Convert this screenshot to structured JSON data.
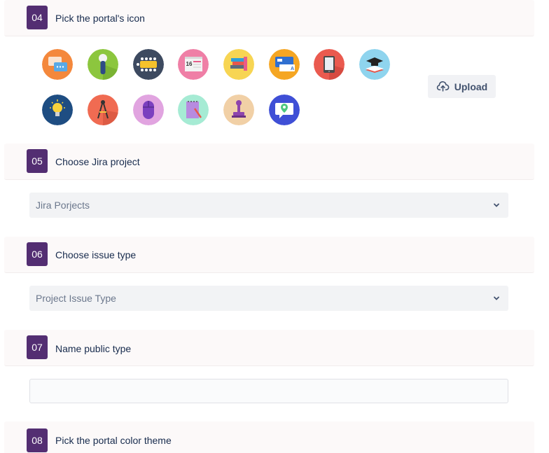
{
  "steps": [
    {
      "number": "04",
      "title": "Pick the portal's icon"
    },
    {
      "number": "05",
      "title": "Choose Jira project"
    },
    {
      "number": "06",
      "title": "Choose issue type"
    },
    {
      "number": "07",
      "title": "Name public type"
    },
    {
      "number": "08",
      "title": "Pick the portal color theme"
    }
  ],
  "icon_picker": {
    "icons": [
      "chat-bubbles-icon",
      "microphone-icon",
      "conference-table-icon",
      "calendar-icon",
      "books-icon",
      "translate-board-icon",
      "tablet-icon",
      "graduation-cap-icon",
      "lightbulb-icon",
      "drafting-compass-icon",
      "computer-mouse-icon",
      "notepad-pencil-icon",
      "stamp-icon",
      "location-pin-chat-icon"
    ],
    "upload_label": "Upload"
  },
  "jira_project": {
    "placeholder": "Jira Porjects"
  },
  "issue_type": {
    "placeholder": "Project Issue Type"
  },
  "public_type": {
    "value": ""
  }
}
